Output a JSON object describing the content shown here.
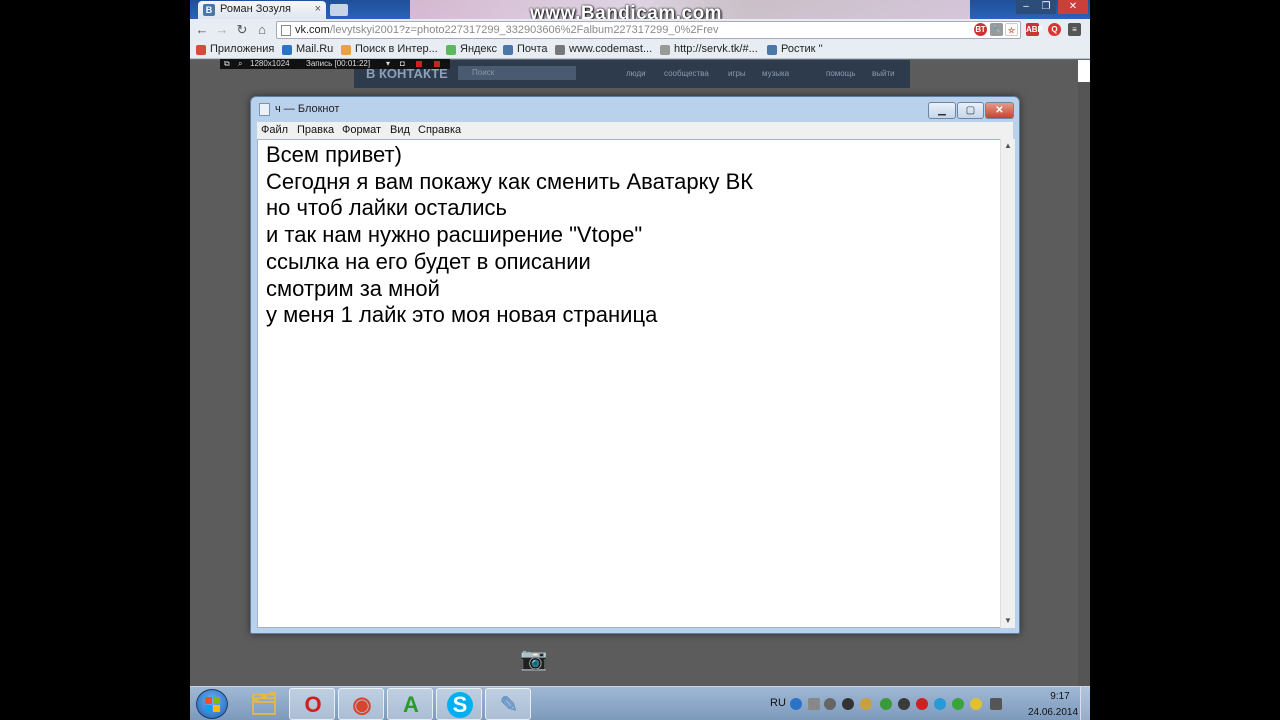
{
  "browser": {
    "tab_title": "Роман Зозуля",
    "tab_favicon": "В",
    "watermark": "www.Bandicam.com",
    "url_host": "vk.com",
    "url_path": "/levytskyi2001?z=photo227317299_332903606%2Falbum227317299_0%2Frev",
    "bookmarks": [
      {
        "label": "Приложения",
        "icon": "apps-grid-icon",
        "color": "#d94a38"
      },
      {
        "label": "Mail.Ru",
        "icon": "mailru-icon",
        "color": "#2a73c9"
      },
      {
        "label": "Поиск в Интер...",
        "icon": "search-globe-icon",
        "color": "#e8a33a"
      },
      {
        "label": "Яндекс",
        "icon": "yandex-download-icon",
        "color": "#5cb85c"
      },
      {
        "label": "Почта",
        "icon": "vk-icon",
        "color": "#4a76a8"
      },
      {
        "label": "www.codemast...",
        "icon": "page-icon",
        "color": "#777777"
      },
      {
        "label": "http://servk.tk/#...",
        "icon": "page-icon",
        "color": "#999999"
      },
      {
        "label": "Ростик ''",
        "icon": "vk-icon",
        "color": "#4a76a8"
      }
    ]
  },
  "recorder": {
    "resolution": "1280x1024",
    "status": "Запись [00:01:22]"
  },
  "vk": {
    "logo": "В КОНТАКТЕ",
    "search_placeholder": "Поиск",
    "menu": [
      "люди",
      "сообщества",
      "игры",
      "музыка",
      "помощь",
      "выйти"
    ]
  },
  "notepad": {
    "title": "ч — Блокнот",
    "menu": [
      "Файл",
      "Правка",
      "Формат",
      "Вид",
      "Справка"
    ],
    "text": "Всем привет)\nСегодня я вам покажу как сменить Аватарку ВК\nно чтоб лайки остались\nи так нам нужно расширение \"Vtope\"\nссылка на его будет в описании\nсмотрим за мной\nу меня 1 лайк это моя новая страница"
  },
  "taskbar": {
    "apps": [
      {
        "name": "explorer",
        "glyph": "🗂"
      },
      {
        "name": "opera",
        "glyph": "O",
        "color": "#d21e1e"
      },
      {
        "name": "chrome",
        "glyph": "◉",
        "color": "#d9442c"
      },
      {
        "name": "aimp",
        "glyph": "A",
        "color": "#3aa33a"
      },
      {
        "name": "skype",
        "glyph": "S",
        "color": "#00aff0"
      },
      {
        "name": "notepad",
        "glyph": "✎",
        "color": "#6f98c6"
      }
    ],
    "lang": "RU",
    "time": "9:17",
    "date": "24.06.2014"
  }
}
